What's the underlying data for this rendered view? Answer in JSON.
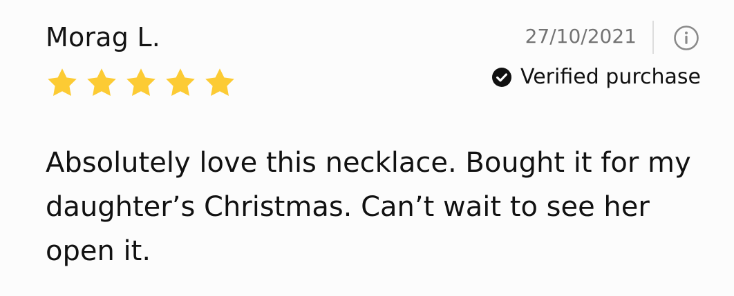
{
  "review": {
    "reviewer_name": "Morag L.",
    "rating": 5,
    "max_rating": 5,
    "date": "27/10/2021",
    "verified_label": "Verified purchase",
    "body": "Absolutely love this necklace. Bought it for my daughter’s Christmas. Can’t wait to see her open it."
  },
  "icons": {
    "star": "star-icon",
    "info": "info-icon",
    "verified": "check-circle-icon"
  },
  "colors": {
    "star": "#FCCB34",
    "text": "#111111",
    "date": "#737373",
    "divider": "#DDDDDD",
    "background": "#FCFCFC",
    "info_icon": "#8A8A8A"
  }
}
